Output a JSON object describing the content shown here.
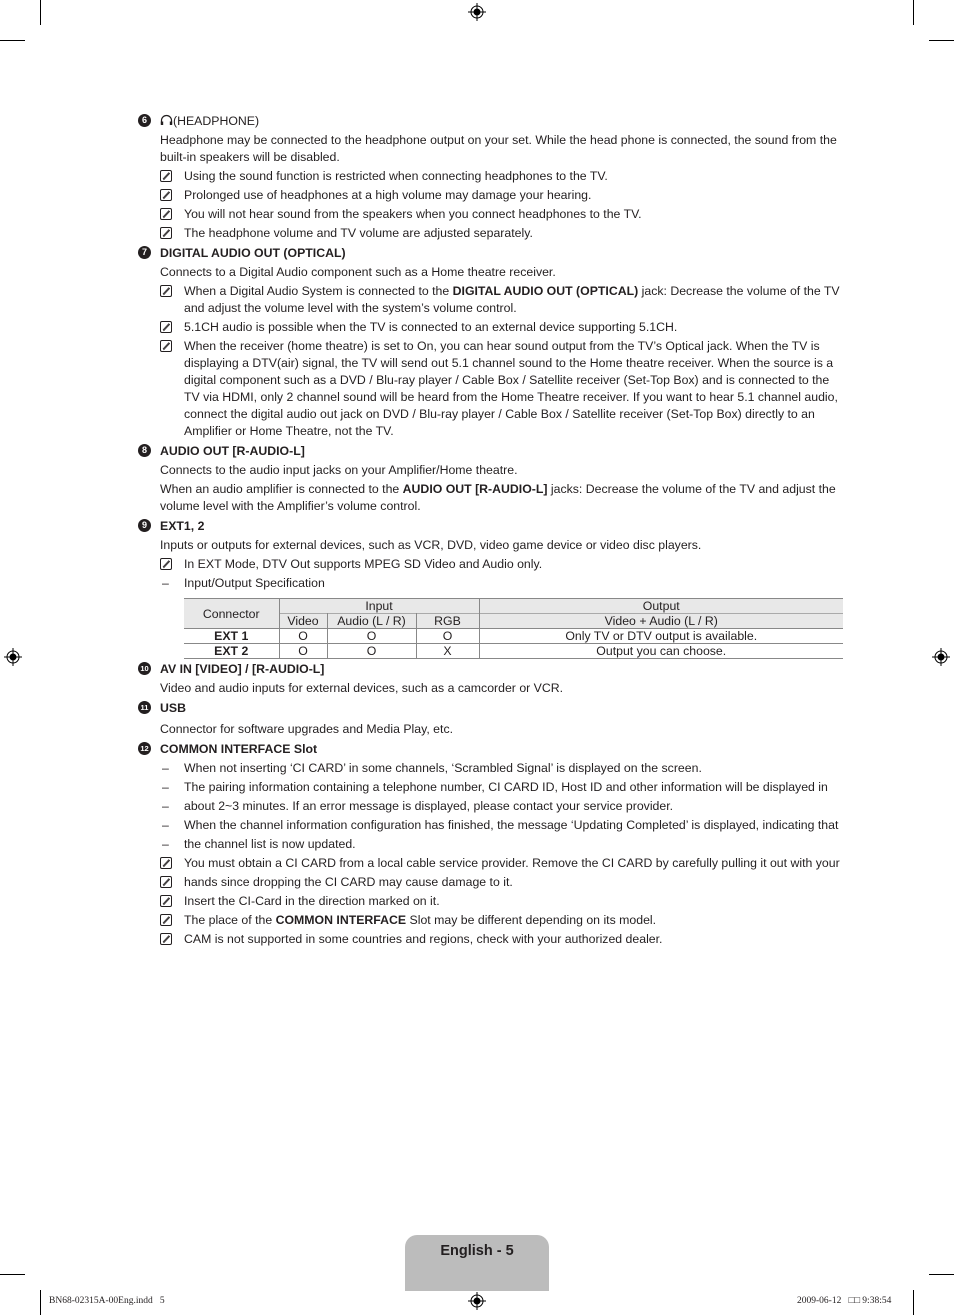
{
  "sections": [
    {
      "number": "6",
      "title": "(HEADPHONE)",
      "title_icon": "headphone-icon",
      "description": "Headphone may be connected to the headphone output on your set. While the head phone is connected, the sound from the built-in speakers will be disabled.",
      "notes": [
        "Using the sound function is restricted when connecting headphones to the TV.",
        "Prolonged use of headphones at a high volume may damage your hearing.",
        "You will not hear sound from the speakers when you connect headphones to the TV.",
        "The headphone volume and TV volume are adjusted separately."
      ]
    },
    {
      "number": "7",
      "title": "DIGITAL AUDIO OUT (OPTICAL)",
      "description": "Connects to a Digital Audio component such as a Home theatre receiver.",
      "note1_pre": "When a Digital Audio System is connected to the ",
      "note1_bold": "DIGITAL AUDIO OUT (OPTICAL)",
      "note1_post": " jack: Decrease the volume of the TV and adjust the volume level with the system’s volume control.",
      "note2": "5.1CH audio is possible when the TV is connected to an external device supporting 5.1CH.",
      "note3": "When the receiver (home theatre) is set to On, you can hear sound output from the TV’s Optical jack. When the TV is displaying a DTV(air) signal, the TV will send out 5.1 channel sound to the Home theatre receiver. When the source is a digital component such as a DVD / Blu-ray player / Cable Box / Satellite receiver (Set-Top Box) and is connected to the TV via HDMI, only 2 channel sound will be heard from the Home Theatre receiver. If you want to hear 5.1 channel audio, connect the digital audio out jack on DVD / Blu-ray player / Cable Box / Satellite receiver (Set-Top Box) directly to an Amplifier or Home Theatre, not the TV."
    },
    {
      "number": "8",
      "title": "AUDIO OUT [R-AUDIO-L]",
      "description": "Connects to the audio input jacks on your Amplifier/Home theatre.",
      "para2_pre": "When an audio amplifier is connected to the ",
      "para2_bold": "AUDIO OUT [R-AUDIO-L]",
      "para2_post": " jacks: Decrease the volume of the TV and adjust the volume level with the Amplifier’s volume control."
    },
    {
      "number": "9",
      "title": "EXT1, 2",
      "description": "Inputs or outputs for external devices, such as VCR, DVD, video game device or video disc players.",
      "note": "In EXT Mode, DTV Out supports MPEG SD Video and Audio only.",
      "dash": "Input/Output Specification",
      "table": {
        "connector_header": "Connector",
        "input_header": "Input",
        "output_header": "Output",
        "sub_headers": [
          "Video",
          "Audio (L / R)",
          "RGB",
          "Video + Audio (L / R)"
        ],
        "rows": [
          {
            "connector": "EXT 1",
            "video": "O",
            "audio": "O",
            "rgb": "O",
            "output": "Only TV or DTV output is available."
          },
          {
            "connector": "EXT 2",
            "video": "O",
            "audio": "O",
            "rgb": "X",
            "output": "Output you can choose."
          }
        ]
      }
    },
    {
      "number": "10",
      "title": "AV IN [VIDEO] / [R-AUDIO-L]",
      "description": "Video and audio inputs for external devices, such as a camcorder or VCR."
    },
    {
      "number": "11",
      "title": "USB",
      "description": "Connector for software upgrades and Media Play, etc."
    },
    {
      "number": "12",
      "title": "COMMON INTERFACE Slot",
      "dashes": [
        "When not inserting ‘CI CARD’ in some channels, ‘Scrambled Signal’ is displayed on the screen.",
        "The pairing information containing a telephone number, CI CARD ID, Host ID and other information will be displayed in",
        "about 2~3 minutes. If an error message is displayed, please contact your service provider.",
        "When the channel information configuration has finished, the message ‘Updating Completed’ is displayed, indicating that",
        "the channel list is now updated."
      ],
      "notes": [
        "You must obtain a CI CARD from a local cable service provider. Remove the CI CARD by carefully pulling it out with your",
        "hands since dropping the CI CARD may cause damage to it.",
        "Insert the CI-Card in the direction marked on it."
      ],
      "note4_pre": "The place of the ",
      "note4_bold": "COMMON INTERFACE",
      "note4_post": " Slot may be different depending on its model.",
      "note5": "CAM is not supported in some countries and regions, check with your authorized dealer."
    }
  ],
  "footer": {
    "page_label": "English - 5",
    "slug_left": "BN68-02315A-00Eng.indd   5",
    "slug_right": "2009-06-12   □□ 9:38:54"
  }
}
